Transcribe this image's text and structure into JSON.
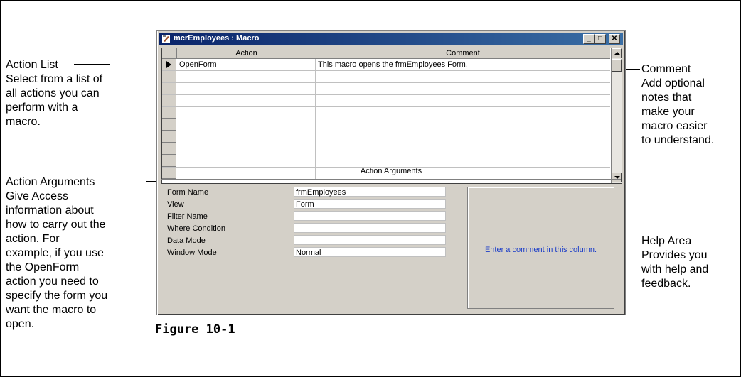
{
  "window": {
    "title": "mcrEmployees : Macro",
    "minimize_glyph": "_",
    "maximize_glyph": "□",
    "close_glyph": "✕"
  },
  "grid": {
    "headers": [
      "Action",
      "Comment"
    ],
    "rows": [
      {
        "action": "OpenForm",
        "comment": "This macro opens the frmEmployees Form."
      },
      {
        "action": "",
        "comment": ""
      },
      {
        "action": "",
        "comment": ""
      },
      {
        "action": "",
        "comment": ""
      },
      {
        "action": "",
        "comment": ""
      },
      {
        "action": "",
        "comment": ""
      },
      {
        "action": "",
        "comment": ""
      },
      {
        "action": "",
        "comment": ""
      },
      {
        "action": "",
        "comment": ""
      },
      {
        "action": "",
        "comment": ""
      }
    ]
  },
  "action_arguments": {
    "title": "Action Arguments",
    "fields": [
      {
        "label": "Form Name",
        "value": "frmEmployees"
      },
      {
        "label": "View",
        "value": "Form"
      },
      {
        "label": "Filter Name",
        "value": ""
      },
      {
        "label": "Where Condition",
        "value": ""
      },
      {
        "label": "Data Mode",
        "value": ""
      },
      {
        "label": "Window Mode",
        "value": "Normal"
      }
    ],
    "help_text": "Enter a comment in this column."
  },
  "callouts": {
    "action_list": {
      "title": "Action List",
      "lines": [
        "Select from a list of",
        "all actions you can",
        "perform with a",
        "macro."
      ]
    },
    "action_arguments": {
      "title": "Action Arguments",
      "lines": [
        "Give Access",
        "information about",
        "how to carry out the",
        "action. For",
        "example, if you use",
        "the OpenForm",
        "action you need to",
        "specify the form you",
        "want the macro to",
        "open."
      ]
    },
    "comment": {
      "title": "Comment",
      "lines": [
        "Add optional",
        "notes that",
        "make your",
        "macro easier",
        "to understand."
      ]
    },
    "help_area": {
      "title": "Help Area",
      "lines": [
        "Provides you",
        "with help and",
        "feedback."
      ]
    }
  },
  "figure_caption": "Figure 10-1"
}
